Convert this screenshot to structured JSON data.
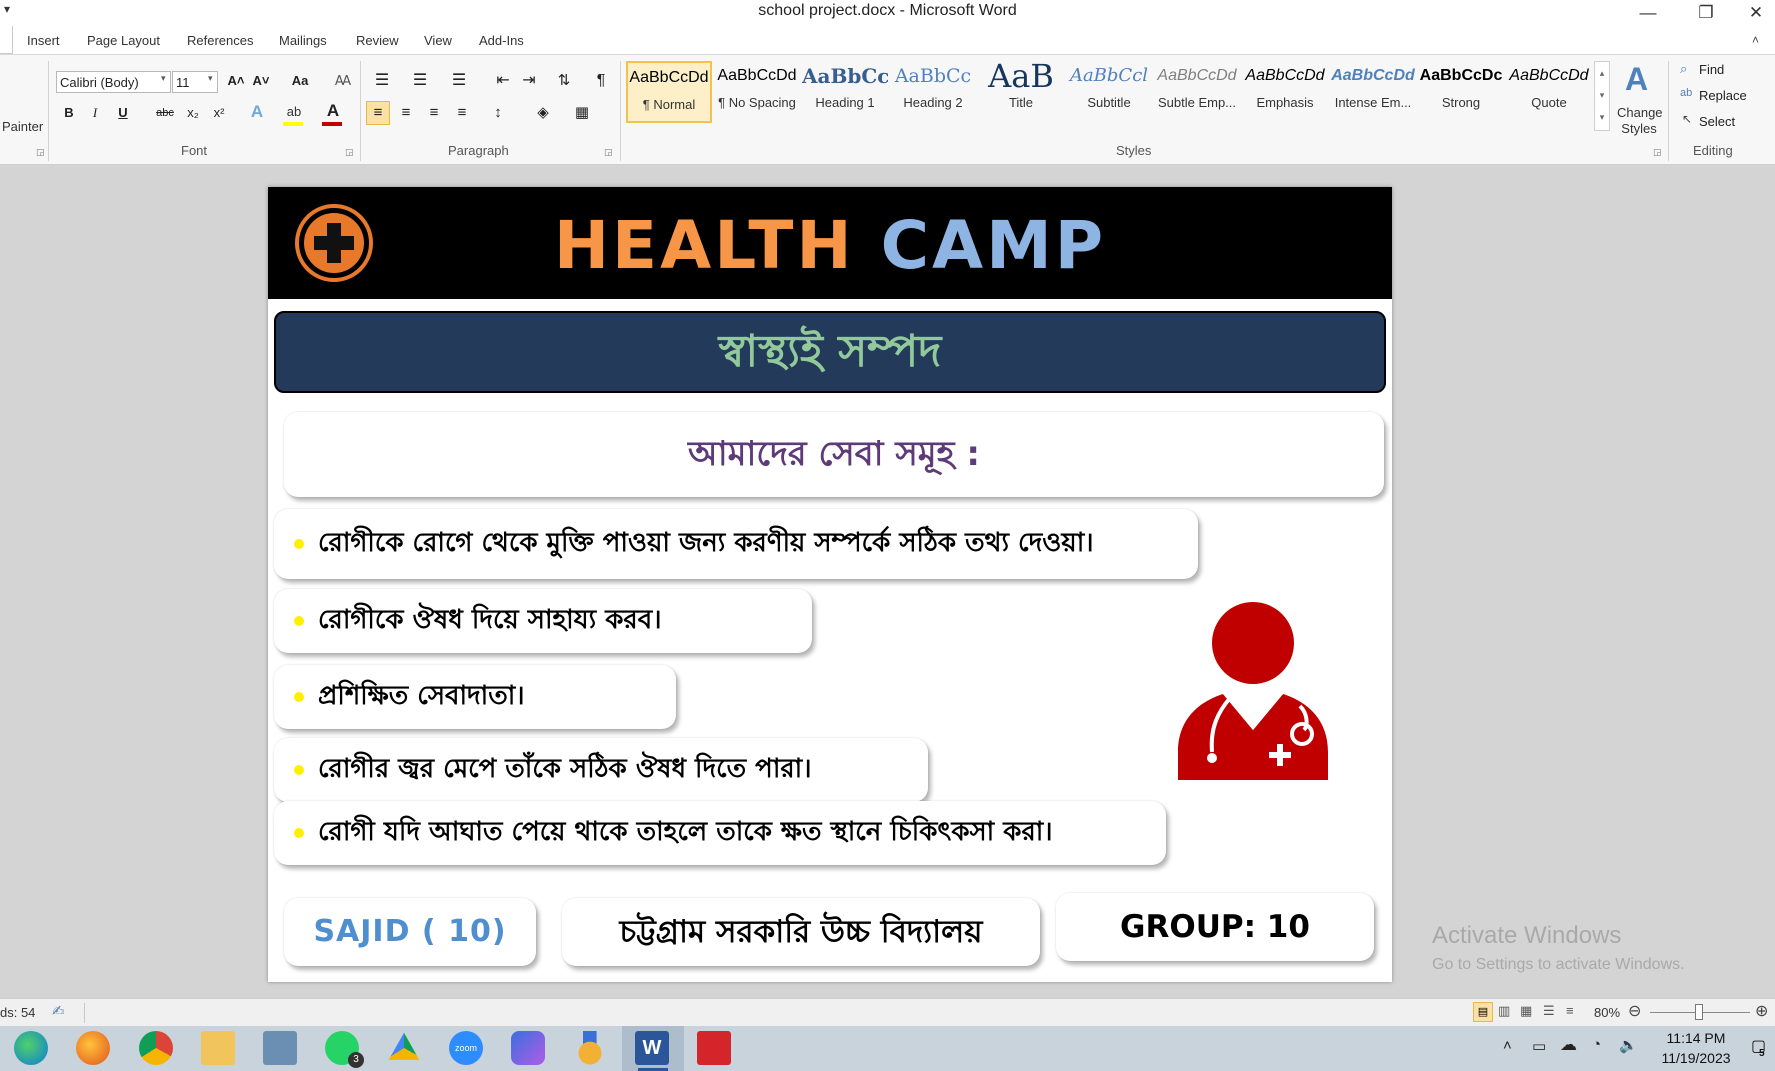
{
  "window": {
    "title": "school project.docx - Microsoft Word",
    "controls": {
      "minimize": "—",
      "restore": "❐",
      "close": "✕"
    }
  },
  "tabs": [
    "Insert",
    "Page Layout",
    "References",
    "Mailings",
    "Review",
    "View",
    "Add-Ins"
  ],
  "ribbon": {
    "clipboard": {
      "painter_label": "Painter"
    },
    "font": {
      "font_name": "Calibri (Body)",
      "font_size": "11",
      "group_label": "Font",
      "bold": "B",
      "italic": "I",
      "underline": "U",
      "strike": "abc",
      "subscript": "x₂",
      "superscript": "x²",
      "grow": "A˄",
      "shrink": "A˅",
      "case": "Aa",
      "font_color": "#c00000",
      "highlight_color": "#ffff00"
    },
    "paragraph": {
      "group_label": "Paragraph",
      "pilcrow": "¶"
    },
    "styles": {
      "group_label": "Styles",
      "items": [
        {
          "sample": "AaBbCcDd",
          "name": "¶ Normal"
        },
        {
          "sample": "AaBbCcDd",
          "name": "¶ No Spacing"
        },
        {
          "sample": "AaBbCc",
          "name": "Heading 1"
        },
        {
          "sample": "AaBbCc",
          "name": "Heading 2"
        },
        {
          "sample": "AaB",
          "name": "Title"
        },
        {
          "sample": "AaBbCcl",
          "name": "Subtitle"
        },
        {
          "sample": "AaBbCcDd",
          "name": "Subtle Emp..."
        },
        {
          "sample": "AaBbCcDd",
          "name": "Emphasis"
        },
        {
          "sample": "AaBbCcDd",
          "name": "Intense Em..."
        },
        {
          "sample": "AaBbCcDc",
          "name": "Strong"
        },
        {
          "sample": "AaBbCcDd",
          "name": "Quote"
        }
      ],
      "change_styles": "Change Styles"
    },
    "editing": {
      "group_label": "Editing",
      "find": "Find",
      "replace": "Replace",
      "select": "Select"
    }
  },
  "document": {
    "banner": {
      "word1": "HEALTH",
      "word2": "CAMP",
      "word1_color": "#f79646",
      "word2_color": "#8eb4e3"
    },
    "subtitle": "স্বাস্থ্যই সম্পদ",
    "services_heading": "আমাদের সেবা সমূহ :",
    "services": [
      "রোগীকে রোগে থেকে মুক্তি পাওয়া জন্য করণীয় সম্পর্কে সঠিক তথ্য দেওয়া।",
      "রোগীকে ঔষধ দিয়ে সাহায্য করব।",
      "প্রশিক্ষিত সেবাদাতা।",
      "রোগীর জ্বর মেপে তাঁকে সঠিক ঔষধ দিতে পারা।",
      "রোগী যদি আঘাত পেয়ে থাকে তাহলে তাকে ক্ষত স্থানে চিকিৎকসা করা।"
    ],
    "footer": {
      "name": "SAJID ( 10)",
      "school": "চট্টগ্রাম সরকারি উচ্চ বিদ্যালয়",
      "group": "GROUP:  10"
    }
  },
  "statusbar": {
    "words": "ds: 54",
    "zoom": "80%"
  },
  "watermark": {
    "line1": "Activate Windows",
    "line2": "Go to Settings to activate Windows."
  },
  "taskbar": {
    "apps": [
      "edge-icon",
      "firefox-icon",
      "chrome-icon",
      "file-explorer-icon",
      "computer-icon",
      "whatsapp-icon",
      "google-drive-icon",
      "zoom-icon",
      "copilot-icon",
      "medal-icon",
      "word-icon",
      "pdf-icon"
    ],
    "whatsapp_badge": "3",
    "zoom_label": "zoom",
    "word_label": "W",
    "time": "11:14 PM",
    "date": "11/19/2023",
    "notification_count": "5"
  }
}
